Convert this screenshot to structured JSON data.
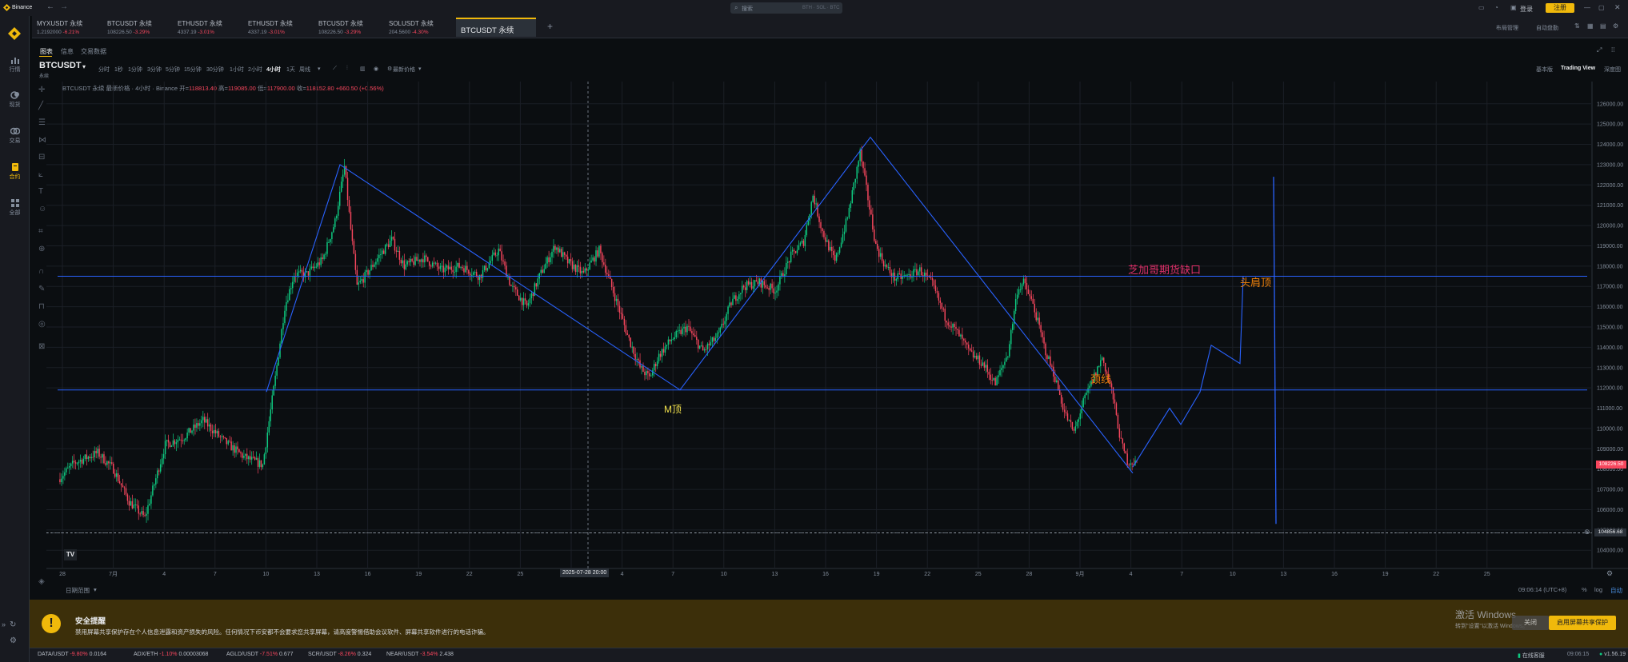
{
  "titlebar": {
    "app_name": "Binance",
    "search_placeholder": "搜索",
    "search_hint": "BTH · SOL · BTC",
    "login_label": "登录",
    "register_label": "注册"
  },
  "tabs": [
    {
      "symbol": "MYXUSDT 永续",
      "price": "1.2192000",
      "change": "-6.21%"
    },
    {
      "symbol": "BTCUSDT 永续",
      "price": "108226.50",
      "change": "-3.29%"
    },
    {
      "symbol": "ETHUSDT 永续",
      "price": "4337.19",
      "change": "-3.01%"
    },
    {
      "symbol": "ETHUSDT 永续",
      "price": "4337.19",
      "change": "-3.01%"
    },
    {
      "symbol": "BTCUSDT 永续",
      "price": "108226.50",
      "change": "-3.29%"
    },
    {
      "symbol": "SOLUSDT 永续",
      "price": "204.5600",
      "change": "-4.30%"
    }
  ],
  "active_tab": "BTCUSDT 永续",
  "new_tab_label": "+",
  "top_right": {
    "layout_label": "布局管理",
    "auto_label": "自动盘勤"
  },
  "sidebar": [
    {
      "label": "行情",
      "icon": "chart-bar-icon"
    },
    {
      "label": "现货",
      "icon": "coins-icon"
    },
    {
      "label": "交易",
      "icon": "exchange-icon"
    },
    {
      "label": "合约",
      "icon": "contract-icon"
    },
    {
      "label": "全部",
      "icon": "grid-icon"
    }
  ],
  "subtabs": [
    "图表",
    "信息",
    "交易数据"
  ],
  "symbol": {
    "name": "BTCUSDT",
    "sub": "永续"
  },
  "timeframes": [
    "分时",
    "1秒",
    "1分钟",
    "3分钟",
    "5分钟",
    "15分钟",
    "30分钟",
    "1小时",
    "2小时",
    "4小时",
    "1天",
    "周线"
  ],
  "active_timeframe": "4小时",
  "price_type_label": "最新价格",
  "views": [
    "基本版",
    "Trading View",
    "深度图"
  ],
  "active_view": "Trading View",
  "ohlc": {
    "prefix": "BTCUSDT 永续 最新价格 · 4小时 · Binance",
    "open_label": "开=",
    "open": "118813.40",
    "high_label": "高=",
    "high": "119085.00",
    "low_label": "低=",
    "low": "117900.00",
    "close_label": "收=",
    "close": "118152.80",
    "change": "+660.50 (+0.56%)"
  },
  "chart_data": {
    "type": "candlestick",
    "y_ticks": [
      "126000.00",
      "125000.00",
      "124000.00",
      "123000.00",
      "122000.00",
      "121000.00",
      "120000.00",
      "119000.00",
      "118000.00",
      "117000.00",
      "116000.00",
      "115000.00",
      "114000.00",
      "113000.00",
      "112000.00",
      "111000.00",
      "110000.00",
      "109000.00",
      "108000.00",
      "107000.00",
      "106000.00",
      "105000.00",
      "104000.00"
    ],
    "ylim": [
      103300,
      126700
    ],
    "x_ticks": [
      "28",
      "7月",
      "4",
      "7",
      "10",
      "13",
      "16",
      "19",
      "22",
      "25",
      "8月",
      "4",
      "7",
      "10",
      "13",
      "16",
      "19",
      "22",
      "25",
      "28",
      "9月",
      "4",
      "7",
      "10",
      "13",
      "16",
      "19",
      "22",
      "25"
    ],
    "crosshair_x_label": "2025-07-28 20:00",
    "crosshair_price": "104856.68",
    "last_price": "108226.50",
    "horizontal_levels": [
      117500,
      111900,
      104856.68
    ],
    "neckline_zigzag_prices": [
      108100,
      111000,
      110200,
      111800,
      114100,
      113200,
      117500
    ],
    "annotations": [
      {
        "text": "芝加哥期货缺口",
        "color": "#e0306a"
      },
      {
        "text": "头肩顶",
        "color": "#f0820b"
      },
      {
        "text": "颈线",
        "color": "#f0820b"
      },
      {
        "text": "M顶",
        "color": "#f0e04b"
      }
    ],
    "candles_summary": "BTCUSDT 4h candles from late June to late August 2025, range approx 105000 to 124500"
  },
  "bottom_bar": {
    "date_range_label": "日期范围",
    "time_label": "09:06:14 (UTC+8)",
    "pct_label": "%",
    "log_label": "log",
    "auto_label": "自动"
  },
  "banner": {
    "title": "安全提醒",
    "body": "禁用屏幕共享保护存在个人信息泄露和资产损失的风险。任何情况下币安都不会要求您共享屏幕，请高度警惕借助会议软件、屏幕共享软件进行的电话诈骗。",
    "watermark_line1": "激活 Windows",
    "watermark_line2": "转到\"设置\"以激活 Windows。",
    "close_label": "关闭",
    "enable_button": "启用屏幕共享保护"
  },
  "ticker": [
    {
      "pair": "DATA/USDT",
      "change": "-9.80%",
      "price": "0.0164"
    },
    {
      "pair": "ADX/ETH",
      "change": "-1.10%",
      "price": "0.00003068"
    },
    {
      "pair": "AGLD/USDT",
      "change": "-7.51%",
      "price": "0.677"
    },
    {
      "pair": "SCR/USDT",
      "change": "-8.26%",
      "price": "0.324"
    },
    {
      "pair": "NEAR/USDT",
      "change": "-3.54%",
      "price": "2.438"
    }
  ],
  "status": {
    "online": "在线客服",
    "time": "09:06:15",
    "version": "v1.56.19"
  },
  "colors": {
    "up": "#0ecb81",
    "down": "#f6465d",
    "line": "#2962ff",
    "accent": "#f0b90b"
  }
}
